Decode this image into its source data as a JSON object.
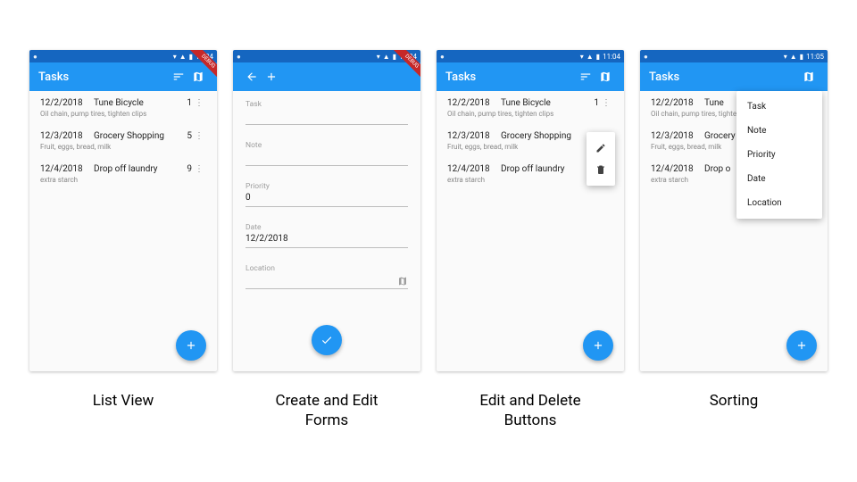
{
  "status": {
    "carrier": "●",
    "time1": "11:04",
    "time2": "11:04",
    "time3": "11:04",
    "time4": "11:05"
  },
  "ribbon": "DEBUG",
  "app_title": "Tasks",
  "tasks": [
    {
      "date": "12/2/2018",
      "name": "Tune Bicycle",
      "priority": "1",
      "note": "Oil chain, pump tires, tighten clips"
    },
    {
      "date": "12/3/2018",
      "name": "Grocery Shopping",
      "priority": "5",
      "note": "Fruit, eggs, bread, milk"
    },
    {
      "date": "12/4/2018",
      "name": "Drop off laundry",
      "priority": "9",
      "note": "extra starch"
    }
  ],
  "form": {
    "task": {
      "label": "Task",
      "value": ""
    },
    "note": {
      "label": "Note",
      "value": ""
    },
    "priority": {
      "label": "Priority",
      "value": "0"
    },
    "date": {
      "label": "Date",
      "value": "12/2/2018"
    },
    "location": {
      "label": "Location",
      "value": ""
    }
  },
  "sort_menu": [
    "Task",
    "Note",
    "Priority",
    "Date",
    "Location"
  ],
  "captions": [
    "List View",
    "Create and Edit\nForms",
    "Edit and Delete\nButtons",
    "Sorting"
  ]
}
